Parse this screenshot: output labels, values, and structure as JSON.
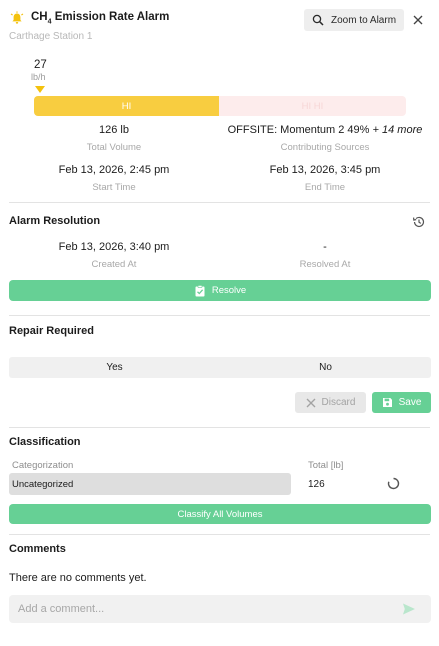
{
  "header": {
    "title_main": "CH",
    "title_sub": "4",
    "title_rest": " Emission Rate Alarm",
    "station": "Carthage Station 1",
    "zoom_label": "Zoom to Alarm"
  },
  "rate": {
    "value": "27",
    "unit": "lb/h",
    "level_hi_label": "HI",
    "level_next_label": "HI HI"
  },
  "stats": {
    "total_volume_value": "126 lb",
    "total_volume_label": "Total Volume",
    "sources_value": "OFFSITE: Momentum 2 49%",
    "sources_more": "+ 14 more",
    "sources_label": "Contributing Sources",
    "start_value": "Feb 13, 2026, 2:45 pm",
    "start_label": "Start Time",
    "end_value": "Feb 13, 2026, 3:45 pm",
    "end_label": "End Time"
  },
  "resolution": {
    "title": "Alarm Resolution",
    "created_value": "Feb 13, 2026, 3:40 pm",
    "created_label": "Created At",
    "resolved_value": "-",
    "resolved_label": "Resolved At",
    "resolve_button": "Resolve"
  },
  "repair": {
    "title": "Repair Required",
    "yes": "Yes",
    "no": "No",
    "discard": "Discard",
    "save": "Save"
  },
  "classification": {
    "title": "Classification",
    "categorization_label": "Categorization",
    "categorization_value": "Uncategorized",
    "total_label": "Total [lb]",
    "total_value": "126",
    "classify_button": "Classify All Volumes"
  },
  "comments": {
    "title": "Comments",
    "empty_text": "There are no comments yet.",
    "placeholder": "Add a comment..."
  },
  "colors": {
    "accent_green": "#66d095",
    "hi_yellow": "#f8cd40",
    "hihi_pink": "#fdecec"
  }
}
